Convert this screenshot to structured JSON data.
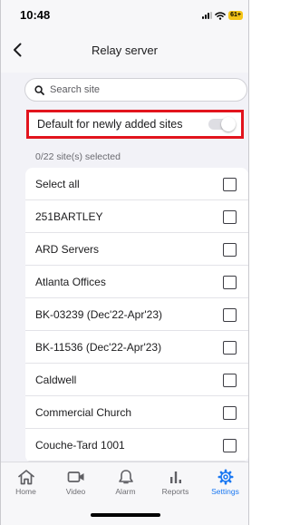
{
  "status": {
    "time": "10:48",
    "battery": "61+"
  },
  "nav": {
    "title": "Relay server",
    "back_icon": "chevron-left-icon"
  },
  "search": {
    "placeholder": "Search site",
    "icon": "search-icon"
  },
  "default_toggle": {
    "label": "Default for newly added sites",
    "on": false
  },
  "selection": {
    "count_text": "0/22 site(s) selected"
  },
  "list": {
    "items": [
      {
        "label": "Select all",
        "checked": false
      },
      {
        "label": "251BARTLEY",
        "checked": false
      },
      {
        "label": "ARD Servers",
        "checked": false
      },
      {
        "label": "Atlanta Offices",
        "checked": false
      },
      {
        "label": "BK-03239 (Dec'22-Apr'23)",
        "checked": false
      },
      {
        "label": "BK-11536 (Dec'22-Apr'23)",
        "checked": false
      },
      {
        "label": "Caldwell",
        "checked": false
      },
      {
        "label": "Commercial Church",
        "checked": false
      },
      {
        "label": "Couche-Tard 1001",
        "checked": false
      }
    ]
  },
  "tabs": [
    {
      "label": "Home",
      "icon": "home-icon",
      "active": false
    },
    {
      "label": "Video",
      "icon": "video-camera-icon",
      "active": false
    },
    {
      "label": "Alarm",
      "icon": "bell-icon",
      "active": false
    },
    {
      "label": "Reports",
      "icon": "bar-chart-icon",
      "active": false
    },
    {
      "label": "Settings",
      "icon": "gear-icon",
      "active": true
    }
  ],
  "colors": {
    "accent": "#1a78f2",
    "highlight_border": "#e2141d",
    "battery": "#f5c518"
  }
}
